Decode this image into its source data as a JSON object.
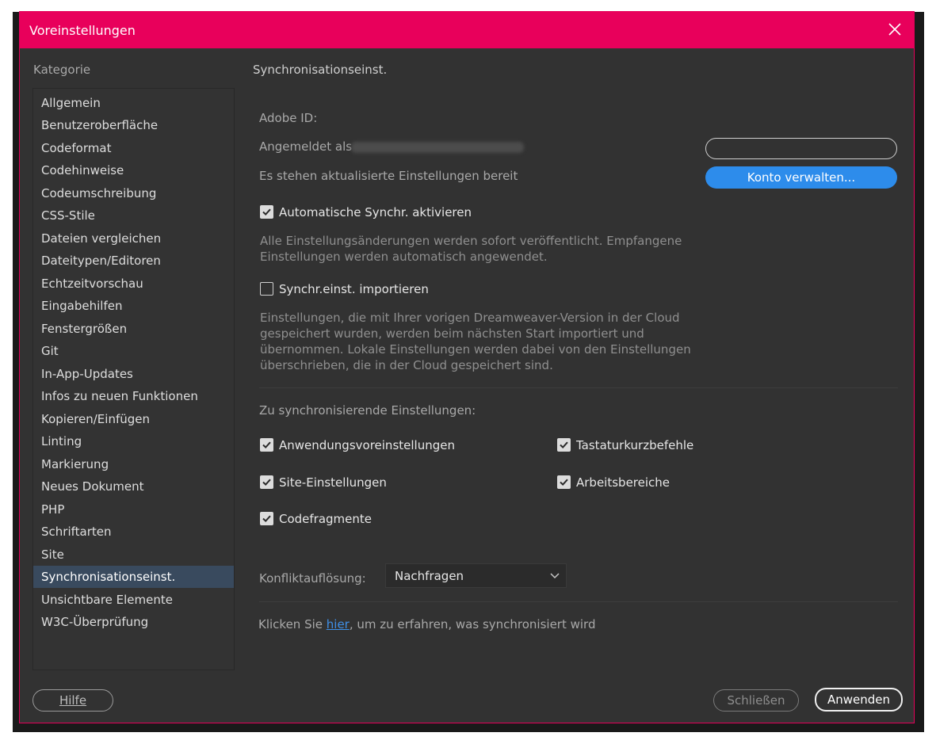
{
  "window": {
    "title": "Voreinstellungen",
    "accent": "#e8005b"
  },
  "sidebar": {
    "header": "Kategorie",
    "items": [
      {
        "label": "Allgemein"
      },
      {
        "label": "Benutzeroberfläche"
      },
      {
        "label": "Codeformat"
      },
      {
        "label": "Codehinweise"
      },
      {
        "label": "Codeumschreibung"
      },
      {
        "label": "CSS-Stile"
      },
      {
        "label": "Dateien vergleichen"
      },
      {
        "label": "Dateitypen/Editoren"
      },
      {
        "label": "Echtzeitvorschau"
      },
      {
        "label": "Eingabehilfen"
      },
      {
        "label": "Fenstergrößen"
      },
      {
        "label": "Git"
      },
      {
        "label": "In-App-Updates"
      },
      {
        "label": "Infos zu neuen Funktionen"
      },
      {
        "label": "Kopieren/Einfügen"
      },
      {
        "label": "Linting"
      },
      {
        "label": "Markierung"
      },
      {
        "label": "Neues Dokument"
      },
      {
        "label": "PHP"
      },
      {
        "label": "Schriftarten"
      },
      {
        "label": "Site"
      },
      {
        "label": "Synchronisationseinst."
      },
      {
        "label": "Unsichtbare Elemente"
      },
      {
        "label": "W3C-Überprüfung"
      }
    ],
    "selected_index": 21
  },
  "main": {
    "section_title": "Synchronisationseinst.",
    "adobe_id_label": "Adobe ID:",
    "signed_in_label": "Angemeldet als",
    "updates_available": "Es stehen aktualisierte Einstellungen bereit",
    "manage_account_button": "Konto verwalten...",
    "auto_sync": {
      "label": "Automatische Synchr. aktivieren",
      "checked": true,
      "description_lines": [
        "Alle Einstellungsänderungen werden sofort veröffentlicht. Empfangene",
        "Einstellungen werden automatisch angewendet."
      ]
    },
    "import_settings": {
      "label": "Synchr.einst. importieren",
      "checked": false,
      "description_lines": [
        "Einstellungen, die mit Ihrer vorigen Dreamweaver-Version in der Cloud",
        "gespeichert wurden, werden beim nächsten Start importiert und",
        "übernommen. Lokale Einstellungen werden dabei von den Einstellungen",
        "überschrieben, die in der Cloud gespeichert sind."
      ]
    },
    "sync_items_header": "Zu synchronisierende Einstellungen:",
    "sync_items": {
      "app_prefs": {
        "label": "Anwendungsvoreinstellungen",
        "checked": true
      },
      "site_settings": {
        "label": "Site-Einstellungen",
        "checked": true
      },
      "code_snippets": {
        "label": "Codefragmente",
        "checked": true
      },
      "keyboard_shortcuts": {
        "label": "Tastaturkurzbefehle",
        "checked": true
      },
      "workspaces": {
        "label": "Arbeitsbereiche",
        "checked": true
      }
    },
    "conflict_label": "Konfliktauflösung:",
    "conflict_value": "Nachfragen",
    "footer_text_before": "Klicken Sie ",
    "footer_link": "hier",
    "footer_text_after": ", um zu erfahren, was synchronisiert wird"
  },
  "buttons": {
    "help": "Hilfe",
    "close": "Schließen",
    "apply": "Anwenden"
  },
  "colors": {
    "link": "#3f8fe6",
    "primary_button": "#2d8ceb",
    "selection": "#394a5e"
  }
}
